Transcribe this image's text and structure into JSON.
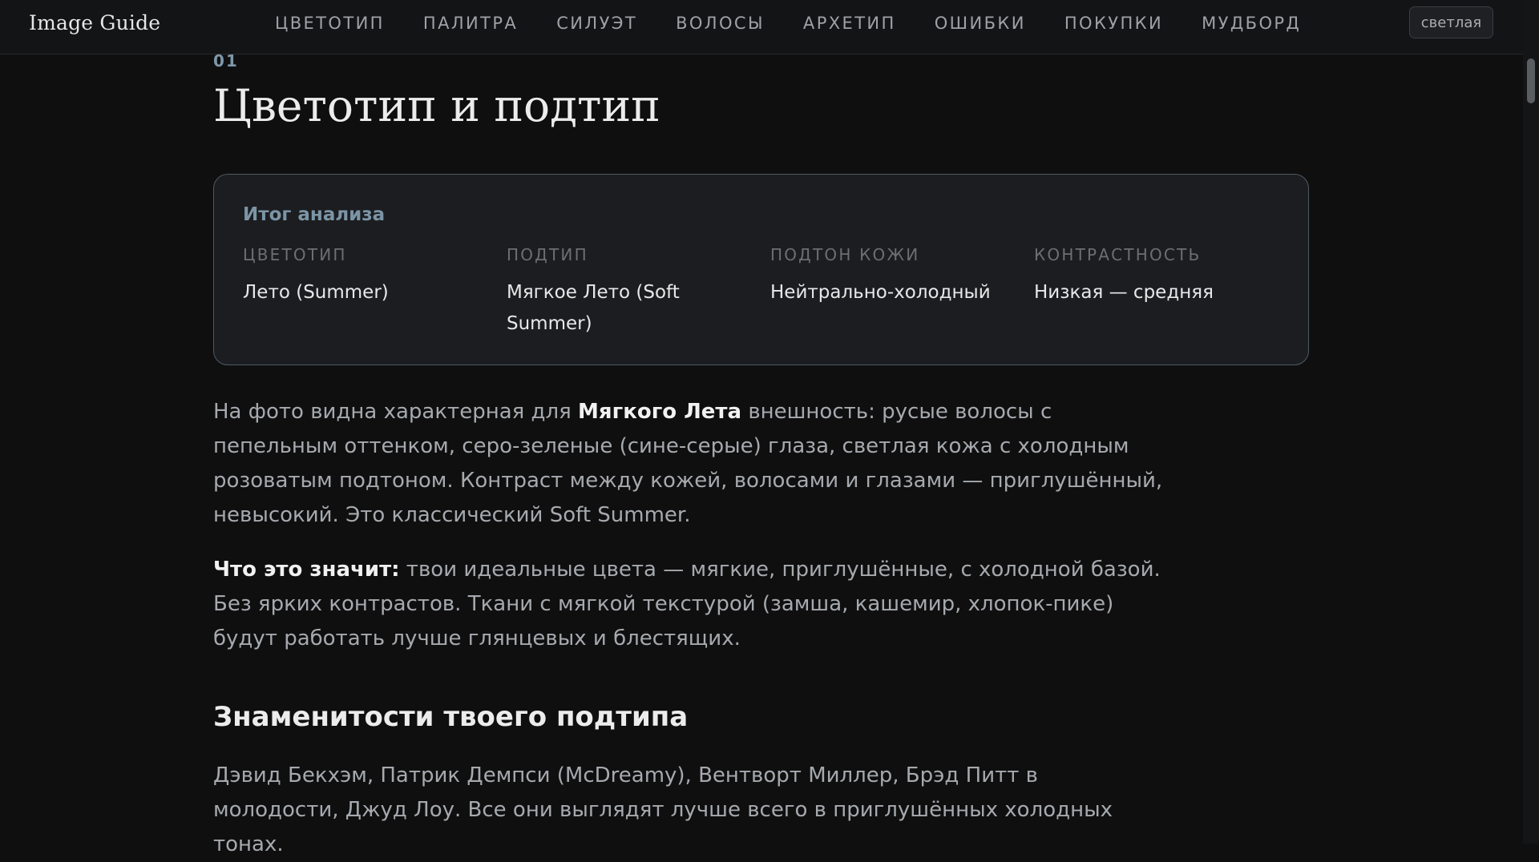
{
  "header": {
    "brand": "Image Guide",
    "nav": [
      "ЦВЕТОТИП",
      "ПАЛИТРА",
      "СИЛУЭТ",
      "ВОЛОСЫ",
      "АРХЕТИП",
      "ОШИБКИ",
      "ПОКУПКИ",
      "МУДБОРД"
    ],
    "theme_toggle": "светлая"
  },
  "section": {
    "number": "01",
    "title": "Цветотип и подтип"
  },
  "summary": {
    "title": "Итог анализа",
    "items": [
      {
        "label": "ЦВЕТОТИП",
        "value": "Лето (Summer)"
      },
      {
        "label": "ПОДТИП",
        "value": "Мягкое Лето (Soft Summer)"
      },
      {
        "label": "ПОДТОН КОЖИ",
        "value": "Нейтрально-холодный"
      },
      {
        "label": "КОНТРАСТНОСТЬ",
        "value": "Низкая — средняя"
      }
    ]
  },
  "paragraph1": {
    "before": "На фото видна характерная для ",
    "bold": "Мягкого Лета",
    "after": " внешность: русые волосы с пепельным оттенком, серо-зеленые (сине-серые) глаза, светлая кожа с холодным розоватым подтоном. Контраст между кожей, волосами и глазами — приглушённый, невысокий. Это классический Soft Summer."
  },
  "paragraph2": {
    "bold": "Что это значит:",
    "after": " твои идеальные цвета — мягкие, приглушённые, с холодной базой. Без ярких контрастов. Ткани с мягкой текстурой (замша, кашемир, хлопок-пике) будут работать лучше глянцевых и блестящих."
  },
  "celebrities": {
    "heading": "Знаменитости твоего подтипа",
    "text": "Дэвид Бекхэм, Патрик Демпси (McDreamy), Вентворт Миллер, Брэд Питт в молодости, Джуд Лоу. Все они выглядят лучше всего в приглушённых холодных тонах."
  },
  "colors": {
    "background": "#0f0f10",
    "card": "#1b1d20",
    "accent": "#7c95a6",
    "text": "#a6a9ad",
    "heading": "#ececec"
  }
}
